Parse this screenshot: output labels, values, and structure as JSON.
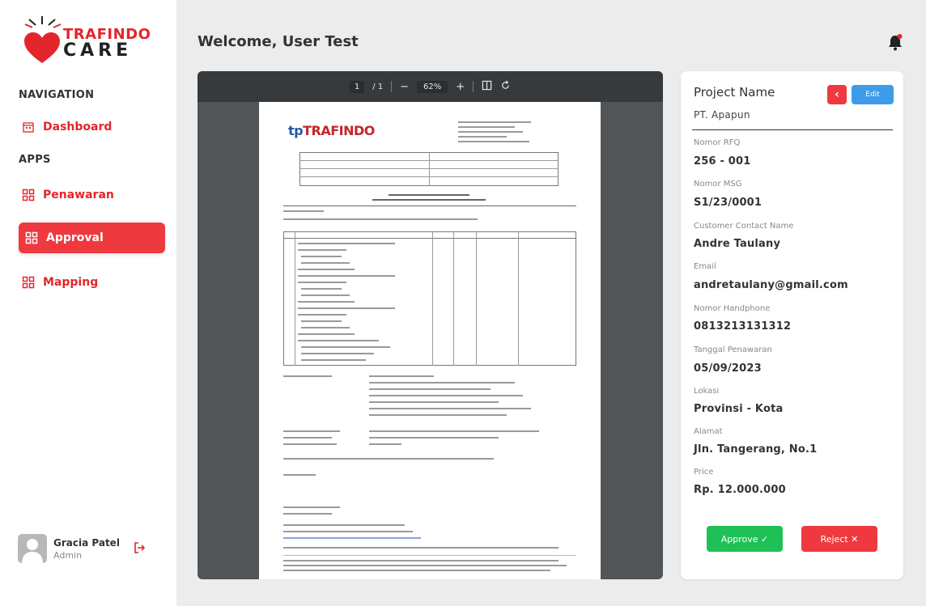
{
  "brand": {
    "line1": "TRAFINDO",
    "line2": "CARE"
  },
  "sidebar": {
    "nav_heading": "NAVIGATION",
    "apps_heading": "APPS",
    "items": [
      {
        "label": "Dashboard",
        "icon": "calendar-icon"
      },
      {
        "label": "Penawaran",
        "icon": "grid-icon"
      },
      {
        "label": "Approval",
        "icon": "grid-icon",
        "active": true
      },
      {
        "label": "Mapping",
        "icon": "grid-icon"
      }
    ],
    "user": {
      "name": "Gracia Patel",
      "role": "Admin"
    }
  },
  "header": {
    "welcome": "Welcome, User Test"
  },
  "viewer": {
    "page_current": "1",
    "page_total": "/ 1",
    "zoom": "62%",
    "doc_logo_tp": "tp",
    "doc_logo_name": "TRAFINDO"
  },
  "detail": {
    "title": "Project Name",
    "project": "PT. Apapun",
    "edit_label": "Edit",
    "fields": [
      {
        "label": "Nomor RFQ",
        "value": "256 - 001"
      },
      {
        "label": "Nomor MSG",
        "value": "S1/23/0001"
      },
      {
        "label": "Customer Contact Name",
        "value": "Andre Taulany"
      },
      {
        "label": "Email",
        "value": "andretaulany@gmail.com"
      },
      {
        "label": "Nomor Handphone",
        "value": "0813213131312"
      },
      {
        "label": "Tanggal Penawaran",
        "value": "05/09/2023"
      },
      {
        "label": "Lokasi",
        "value": "Provinsi - Kota"
      },
      {
        "label": "Alamat",
        "value": "Jln. Tangerang, No.1"
      },
      {
        "label": "Price",
        "value": "Rp. 12.000.000"
      }
    ],
    "approve_label": "Approve ✓",
    "reject_label": "Reject ✕"
  },
  "colors": {
    "brand_red": "#ee3a3f",
    "approve_green": "#1fc157",
    "edit_blue": "#3d9be9"
  }
}
